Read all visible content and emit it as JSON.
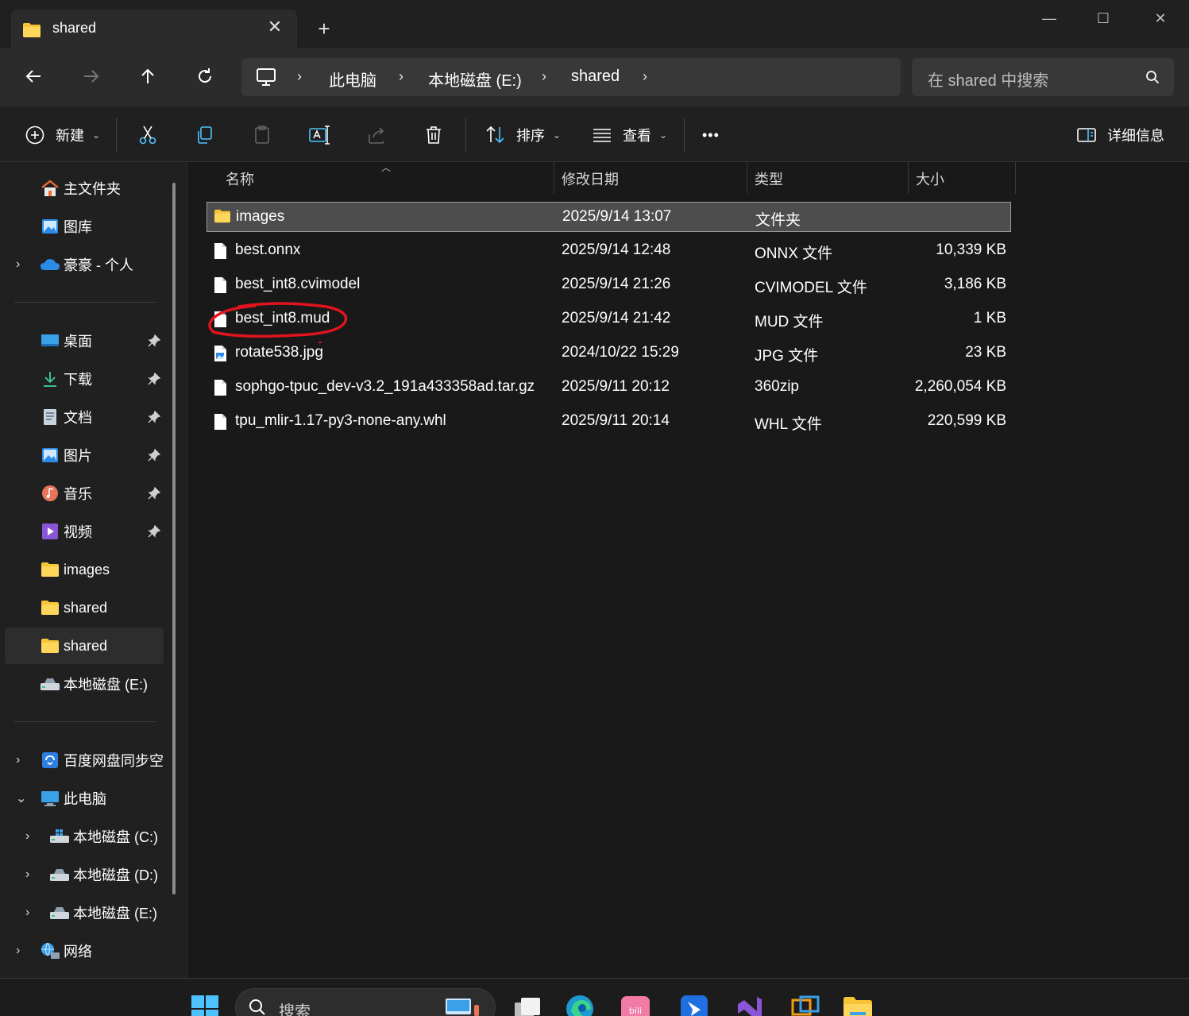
{
  "tab": {
    "title": "shared"
  },
  "breadcrumb": [
    "此电脑",
    "本地磁盘 (E:)",
    "shared"
  ],
  "search": {
    "placeholder": "在 shared 中搜索"
  },
  "commandbar": {
    "new_label": "新建",
    "sort_label": "排序",
    "view_label": "查看",
    "more_label": "•••",
    "details_label": "详细信息"
  },
  "sidebar": {
    "quick": [
      {
        "label": "主文件夹",
        "icon": "home-icon"
      },
      {
        "label": "图库",
        "icon": "gallery-icon"
      },
      {
        "label": "豪豪 - 个人",
        "icon": "onedrive-icon",
        "expandable": true
      }
    ],
    "pinned": [
      {
        "label": "桌面",
        "icon": "desktop-icon",
        "pinned": true
      },
      {
        "label": "下载",
        "icon": "download-icon",
        "pinned": true
      },
      {
        "label": "文档",
        "icon": "documents-icon",
        "pinned": true
      },
      {
        "label": "图片",
        "icon": "pictures-icon",
        "pinned": true
      },
      {
        "label": "音乐",
        "icon": "music-icon",
        "pinned": true
      },
      {
        "label": "视频",
        "icon": "videos-icon",
        "pinned": true
      },
      {
        "label": "images",
        "icon": "folder-icon"
      },
      {
        "label": "shared",
        "icon": "folder-icon"
      },
      {
        "label": "shared",
        "icon": "folder-icon",
        "selected": true
      },
      {
        "label": "本地磁盘 (E:)",
        "icon": "drive-icon"
      }
    ],
    "tree": [
      {
        "label": "百度网盘同步空",
        "icon": "baidu-sync-icon",
        "chevron": "collapsed"
      },
      {
        "label": "此电脑",
        "icon": "this-pc-icon",
        "chevron": "expanded"
      },
      {
        "label": "本地磁盘 (C:)",
        "icon": "windows-drive-icon",
        "chevron": "collapsed",
        "indent": true
      },
      {
        "label": "本地磁盘 (D:)",
        "icon": "drive-icon",
        "chevron": "collapsed",
        "indent": true
      },
      {
        "label": "本地磁盘 (E:)",
        "icon": "drive-icon",
        "chevron": "collapsed",
        "indent": true
      },
      {
        "label": "网络",
        "icon": "network-icon",
        "chevron": "collapsed"
      }
    ]
  },
  "columns": {
    "name": "名称",
    "date": "修改日期",
    "type": "类型",
    "size": "大小"
  },
  "files": [
    {
      "name": "images",
      "date": "2025/9/14 13:07",
      "type": "文件夹",
      "size": "",
      "kind": "folder",
      "selected": true
    },
    {
      "name": "best.onnx",
      "date": "2025/9/14 12:48",
      "type": "ONNX 文件",
      "size": "10,339 KB",
      "kind": "file"
    },
    {
      "name": "best_int8.cvimodel",
      "date": "2025/9/14 21:26",
      "type": "CVIMODEL 文件",
      "size": "3,186 KB",
      "kind": "file"
    },
    {
      "name": "best_int8.mud",
      "date": "2025/9/14 21:42",
      "type": "MUD 文件",
      "size": "1 KB",
      "kind": "file",
      "annotated": true
    },
    {
      "name": "rotate538.jpg",
      "date": "2024/10/22 15:29",
      "type": "JPG 文件",
      "size": "23 KB",
      "kind": "image"
    },
    {
      "name": "sophgo-tpuc_dev-v3.2_191a433358ad.tar.gz",
      "date": "2025/9/11 20:12",
      "type": "360zip",
      "size": "2,260,054 KB",
      "kind": "file"
    },
    {
      "name": "tpu_mlir-1.17-py3-none-any.whl",
      "date": "2025/9/11 20:14",
      "type": "WHL 文件",
      "size": "220,599 KB",
      "kind": "file"
    }
  ],
  "taskbar": {
    "search_placeholder": "搜索",
    "apps": [
      "start-icon",
      "task-view-icon",
      "edge-icon",
      "bilibili-icon",
      "feishu-icon",
      "visual-studio-icon",
      "remote-desktop-icon",
      "file-explorer-icon"
    ]
  },
  "colors": {
    "accent": "#4cc2ff",
    "folder": "#f8c537",
    "annotation": "#e0141e"
  }
}
